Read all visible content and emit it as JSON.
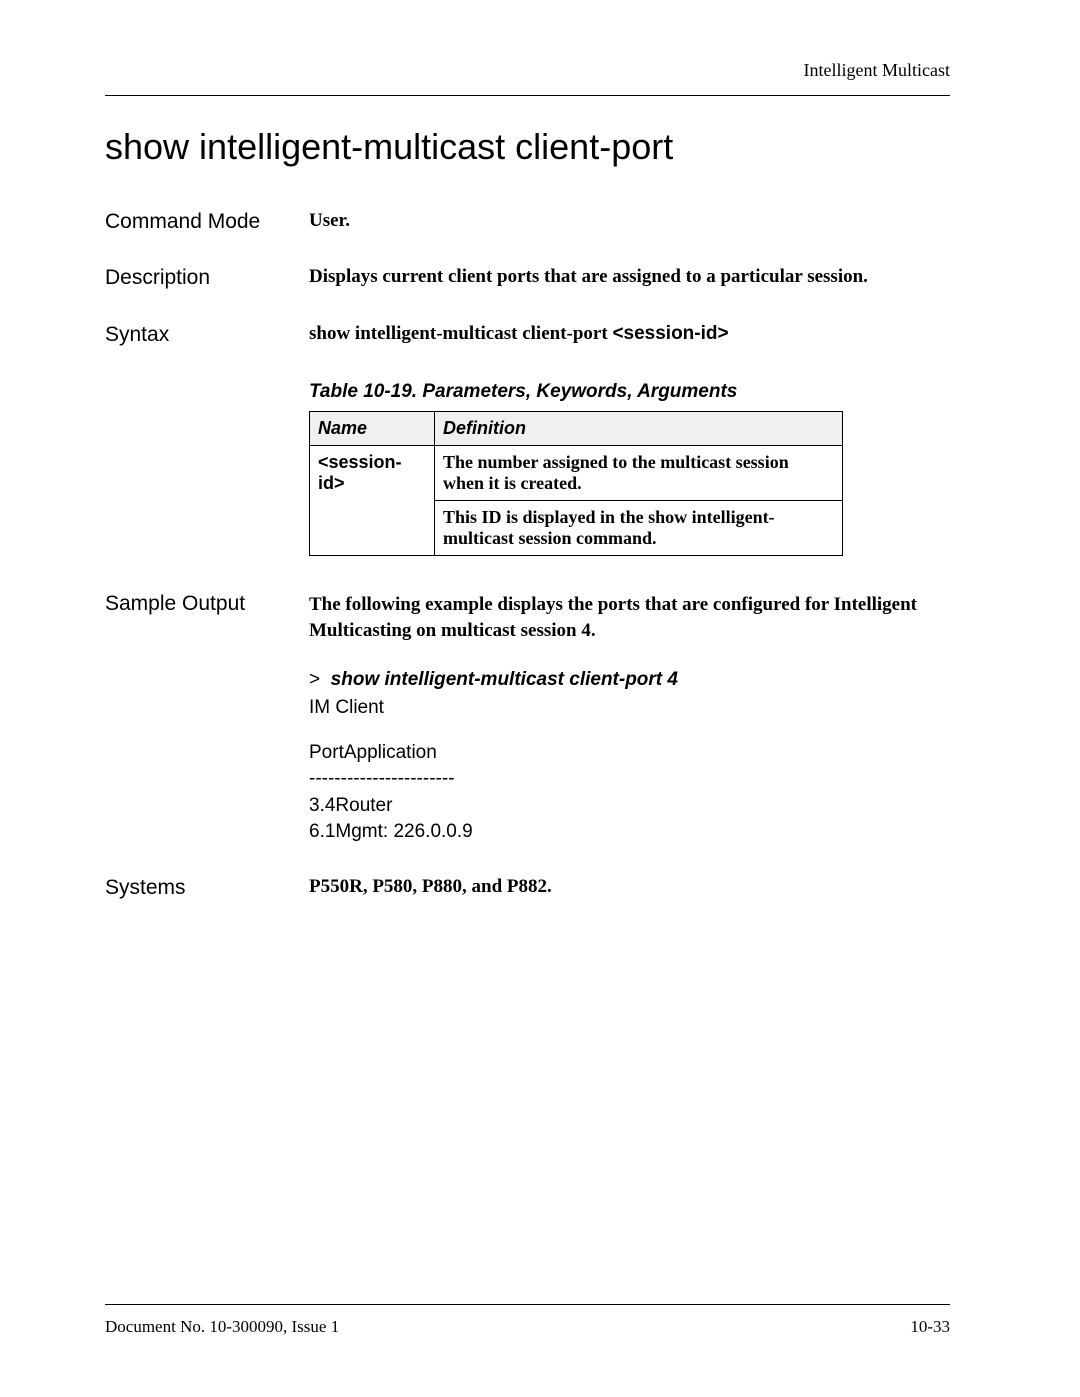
{
  "running_head": "Intelligent Multicast",
  "title": "show intelligent-multicast client-port",
  "fields": {
    "command_mode": {
      "label": "Command Mode",
      "value": "User."
    },
    "description": {
      "label": "Description",
      "value": "Displays current client ports that are assigned to a particular session."
    },
    "syntax_label": "Syntax",
    "syntax_prefix": "show intelligent-multicast client-port ",
    "syntax_arg": "<session-id>",
    "sample_output_label": "Sample Output",
    "sample_intro": "The following example displays the ports that are configured for Intelligent Multicasting on multicast session 4.",
    "sample_prompt": ">",
    "sample_cmd": "show intelligent-multicast client-port 4",
    "sample_lines": {
      "l1": "IM Client",
      "l2": "PortApplication",
      "l3": "-----------------------",
      "l4": "3.4Router",
      "l5": "6.1Mgmt: 226.0.0.9"
    },
    "systems": {
      "label": "Systems",
      "value": "P550R, P580, P880, and P882."
    }
  },
  "table": {
    "caption": "Table 10-19.  Parameters, Keywords, Arguments",
    "head_name": "Name",
    "head_def": "Definition",
    "row_name": "<session-id>",
    "row_def1": "The number assigned to the multicast session when it is created.",
    "row_def2": "This ID is displayed in the show intelligent-multicast session command."
  },
  "footer": {
    "left": "Document No. 10-300090, Issue 1",
    "right": "10-33"
  }
}
